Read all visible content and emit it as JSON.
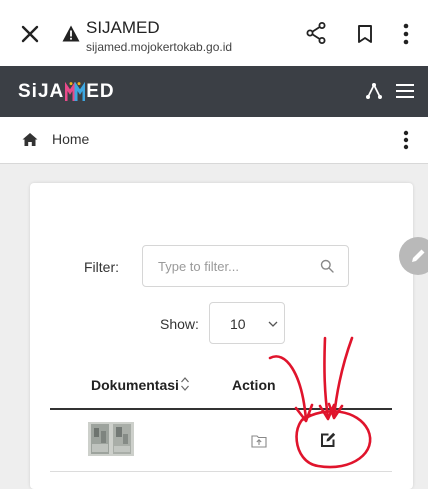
{
  "browser": {
    "site_title": "SIJAMED",
    "site_url": "sijamed.mojokertokab.go.id",
    "icons": [
      "close-icon",
      "warning-icon",
      "share-icon",
      "bookmark-icon",
      "more-vert-icon"
    ]
  },
  "app": {
    "logo_left": "SiJA",
    "logo_right": "ED",
    "header_bg": "#3b3f45",
    "icons": [
      "sitemap-icon",
      "hamburger-menu-icon"
    ]
  },
  "breadcrumb": {
    "home_label": "Home"
  },
  "filter": {
    "label": "Filter:",
    "placeholder": "Type to filter..."
  },
  "show": {
    "label": "Show:",
    "value": "10"
  },
  "table": {
    "headers": [
      "Dokumentasi",
      "Action"
    ]
  },
  "annotation": {
    "color": "#e0142c"
  }
}
